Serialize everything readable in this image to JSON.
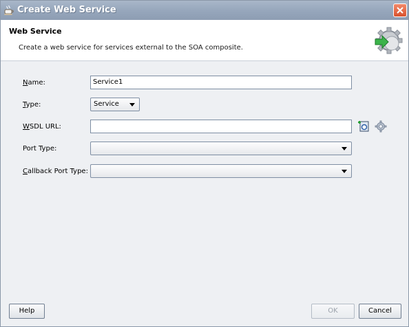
{
  "window": {
    "title": "Create Web Service"
  },
  "header": {
    "title": "Web Service",
    "description": "Create a web service for services external to the SOA composite."
  },
  "form": {
    "name": {
      "label_mnemonic": "N",
      "label_rest": "ame:",
      "value": "Service1"
    },
    "type": {
      "label_mnemonic": "T",
      "label_rest": "ype:",
      "value": "Service"
    },
    "wsdl_url": {
      "label_mnemonic": "W",
      "label_rest": "SDL URL:",
      "value": ""
    },
    "port_type": {
      "label_prefix": "Port Type:",
      "value": ""
    },
    "callback_port_type": {
      "label_mnemonic": "C",
      "label_rest": "allback Port Type:",
      "value": ""
    }
  },
  "buttons": {
    "help": "Help",
    "ok": "OK",
    "cancel": "Cancel"
  },
  "icons": {
    "title": "coffee-cup-icon",
    "header": "gear-arrow-icon",
    "close": "close-icon",
    "browse_wsdl": "browse-wsdl-icon",
    "find_wsdl": "service-explorer-icon"
  },
  "colors": {
    "titlebar": "#97a7bc",
    "body_background": "#eef0f3",
    "close_button": "#d8512d"
  }
}
